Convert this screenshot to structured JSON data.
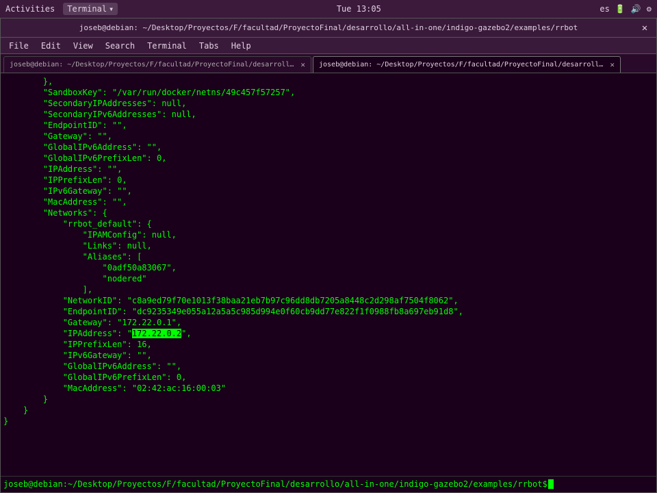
{
  "system_bar": {
    "activities": "Activities",
    "terminal_btn": "Terminal",
    "chevron": "▾",
    "time": "Tue 13:05",
    "lang": "es",
    "icons": [
      "battery",
      "volume",
      "settings"
    ]
  },
  "window": {
    "title": "joseb@debian: ~/Desktop/Proyectos/F/facultad/ProyectoFinal/desarrollo/all-in-one/indigo-gazebo2/examples/rrbot",
    "close": "✕"
  },
  "menu": {
    "items": [
      "File",
      "Edit",
      "View",
      "Search",
      "Terminal",
      "Tabs",
      "Help"
    ]
  },
  "tabs": [
    {
      "label": "joseb@debian: ~/Desktop/Proyectos/F/facultad/ProyectoFinal/desarrollo/all-in-one/indigo...",
      "active": false,
      "close": "✕"
    },
    {
      "label": "joseb@debian: ~/Desktop/Proyectos/F/facultad/ProyectoFinal/desarrollo/all-in-one/indigo...",
      "active": true,
      "close": "✕"
    }
  ],
  "terminal": {
    "lines": [
      "        },",
      "        \"SandboxKey\": \"/var/run/docker/netns/49c457f57257\",",
      "        \"SecondaryIPAddresses\": null,",
      "        \"SecondaryIPv6Addresses\": null,",
      "        \"EndpointID\": \"\",",
      "        \"Gateway\": \"\",",
      "        \"GlobalIPv6Address\": \"\",",
      "        \"GlobalIPv6PrefixLen\": 0,",
      "        \"IPAddress\": \"\",",
      "        \"IPPrefixLen\": 0,",
      "        \"IPv6Gateway\": \"\",",
      "        \"MacAddress\": \"\",",
      "        \"Networks\": {",
      "            \"rrbot_default\": {",
      "                \"IPAMConfig\": null,",
      "                \"Links\": null,",
      "                \"Aliases\": [",
      "                    \"0adf50a83067\",",
      "                    \"nodered\"",
      "                ],",
      "            \"NetworkID\": \"c8a9ed79f70e1013f38baa21eb7b97c96dd8db7205a8448c2d298af7504f8062\",",
      "            \"EndpointID\": \"dc9235349e055a12a5a5c985d994e0f60cb9dd77e822f1f0988fb8a697eb91d8\",",
      "            \"Gateway\": \"172.22.0.1\",",
      "            \"IPAddress\": \"172.22.0.2\",",
      "            \"IPPrefixLen\": 16,",
      "            \"IPv6Gateway\": \"\",",
      "            \"GlobalIPv6Address\": \"\",",
      "            \"GlobalIPv6PrefixLen\": 0,",
      "            \"MacAddress\": \"02:42:ac:16:00:03\"",
      "        }",
      "    }",
      "}"
    ],
    "highlight_line": 23,
    "highlight_text": "172.22.0.2",
    "prompt": "joseb@debian:~/Desktop/Proyectos/F/facultad/ProyectoFinal/desarrollo/all-in-one/indigo-gazebo2/examples/rrbot$"
  }
}
